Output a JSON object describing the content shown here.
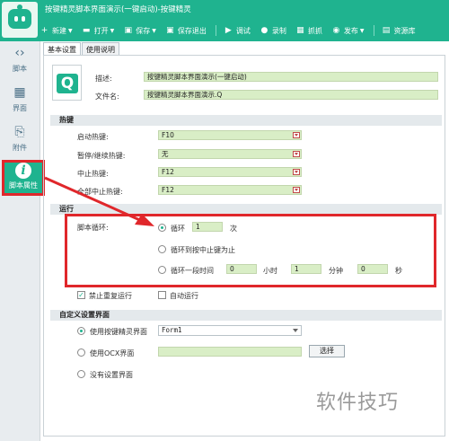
{
  "window": {
    "title": "按键精灵脚本界面演示(一键启动)-按键精灵"
  },
  "toolbar": [
    {
      "icon": "plus-icon",
      "glyph": "+",
      "label": "新建",
      "caret": true
    },
    {
      "icon": "folder-icon",
      "glyph": "▬",
      "label": "打开",
      "caret": true
    },
    {
      "icon": "save-icon",
      "glyph": "▣",
      "label": "保存",
      "caret": true
    },
    {
      "icon": "save-exit-icon",
      "glyph": "▣",
      "label": "保存退出",
      "caret": false
    },
    {
      "icon": "play-icon",
      "glyph": "▶",
      "label": "调试",
      "caret": false
    },
    {
      "icon": "record-icon",
      "glyph": "●",
      "label": "录制",
      "caret": false
    },
    {
      "icon": "capture-icon",
      "glyph": "▦",
      "label": "抓抓",
      "caret": false
    },
    {
      "icon": "publish-icon",
      "glyph": "◉",
      "label": "发布",
      "caret": true
    },
    {
      "icon": "resource-icon",
      "glyph": "▤",
      "label": "资源库",
      "caret": false
    }
  ],
  "sidebar": [
    {
      "icon": "script-icon",
      "glyph": "‹›",
      "label": "脚本"
    },
    {
      "icon": "ui-icon",
      "glyph": "▦",
      "label": "界面"
    },
    {
      "icon": "attachment-icon",
      "glyph": "⎘",
      "label": "附件"
    },
    {
      "icon": "info-icon",
      "glyph": "i",
      "label": "脚本属性",
      "active": true
    }
  ],
  "tabs": [
    "基本设置",
    "使用说明"
  ],
  "basic": {
    "file_glyph": "Q",
    "desc_label": "描述:",
    "desc_value": "按键精灵脚本界面演示(一键启动)",
    "filename_label": "文件名:",
    "filename_value": "按键精灵脚本界面演示.Q"
  },
  "hotkeys": {
    "title": "热键",
    "items": [
      {
        "label": "启动热键:",
        "value": "F10"
      },
      {
        "label": "暂停/继续热键:",
        "value": "无"
      },
      {
        "label": "中止热键:",
        "value": "F12"
      },
      {
        "label": "全部中止热键:",
        "value": "F12"
      }
    ]
  },
  "run": {
    "title": "运行",
    "loop_label": "脚本循环:",
    "opt_loop": "循环",
    "loop_count": "1",
    "loop_unit": "次",
    "opt_until_stop": "循环到按中止键为止",
    "opt_duration": "循环一段时间",
    "hours": "0",
    "hours_unit": "小时",
    "minutes": "1",
    "minutes_unit": "分钟",
    "seconds": "0",
    "seconds_unit": "秒",
    "no_repeat": "禁止重复运行",
    "auto_run": "自动运行"
  },
  "custom_ui": {
    "title": "自定义设置界面",
    "opt_builtin": "使用按键精灵界面",
    "form_value": "Form1",
    "opt_ocx": "使用OCX界面",
    "choose_button": "选择",
    "opt_none": "没有设置界面"
  },
  "watermark": "软件技巧"
}
